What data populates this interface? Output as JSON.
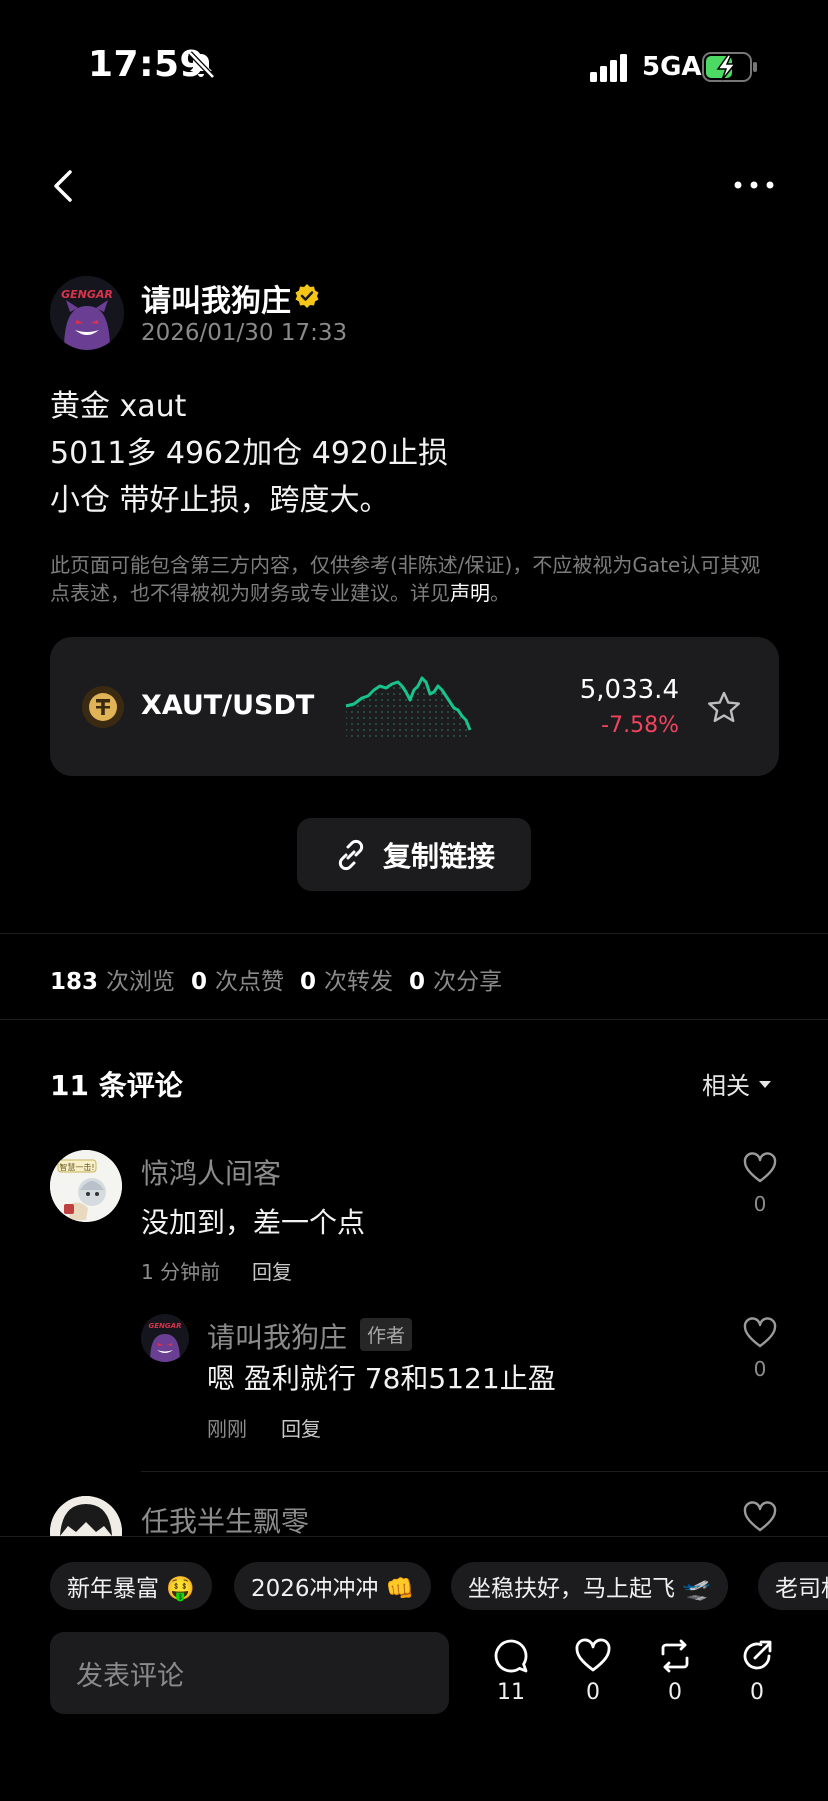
{
  "status_bar": {
    "time": "17:59",
    "network": "5GA"
  },
  "post": {
    "author": "请叫我狗庄",
    "date": "2026/01/30 17:33",
    "lines": [
      "黄金 xaut",
      "5011多  4962加仓 4920止损",
      "小仓 带好止损，跨度大。"
    ],
    "disclaimer": "此页面可能包含第三方内容，仅供参考(非陈述/保证)，不应被视为Gate认可其观点表述，也不得被视为财务或专业建议。详见",
    "disclaimer_link": "声明",
    "disclaimer_end": "。"
  },
  "ticker": {
    "pair": "XAUT/USDT",
    "price": "5,033.4",
    "change": "-7.58%"
  },
  "copy_link": {
    "label": "复制链接"
  },
  "stats": [
    {
      "value": "183",
      "label": "次浏览"
    },
    {
      "value": "0",
      "label": "次点赞"
    },
    {
      "value": "0",
      "label": "次转发"
    },
    {
      "value": "0",
      "label": "次分享"
    }
  ],
  "comments": {
    "title": "11 条评论",
    "sort_label": "相关",
    "items": [
      {
        "name": "惊鸿人间客",
        "text": "没加到，差一个点",
        "time": "1 分钟前",
        "reply": "回复",
        "likes": "0"
      },
      {
        "name": "请叫我狗庄",
        "tag": "作者",
        "text": "嗯 盈利就行 78和5121止盈",
        "time": "刚刚",
        "reply": "回复",
        "likes": "0"
      },
      {
        "name": "任我半生飘零"
      }
    ]
  },
  "quick_replies": [
    "新年暴富 🤑",
    "2026冲冲冲 👊",
    "坐稳扶好，马上起飞 🛫",
    "老司机"
  ],
  "composer": {
    "placeholder": "发表评论",
    "actions": [
      {
        "icon": "comment-icon",
        "count": "11"
      },
      {
        "icon": "heart-icon",
        "count": "0"
      },
      {
        "icon": "repost-icon",
        "count": "0"
      },
      {
        "icon": "share-icon",
        "count": "0"
      }
    ]
  },
  "colors": {
    "background": "#000000",
    "card": "#1c1c1e",
    "negative": "#f0435d",
    "sparkline": "#18c48a",
    "verified": "#f5c518"
  }
}
